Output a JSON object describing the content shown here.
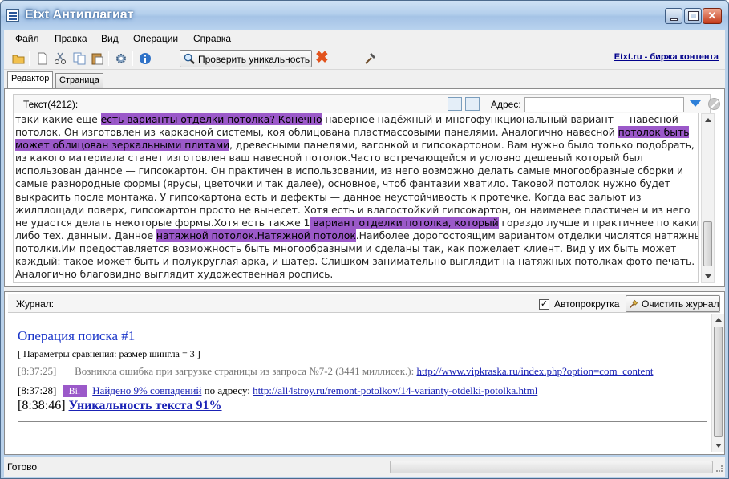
{
  "window": {
    "title": "Etxt Антиплагиат",
    "minimize_glyph": "",
    "close_glyph": "✕"
  },
  "menu": [
    "Файл",
    "Правка",
    "Вид",
    "Операции",
    "Справка"
  ],
  "toolbar": {
    "check_label": "Проверить уникальность",
    "link_label": "Etxt.ru - биржа контента"
  },
  "tabs": [
    "Редактор",
    "Страница"
  ],
  "editor": {
    "text_label": "Текст(4212):",
    "address_label": "Адрес:",
    "address_value": "",
    "lines": [
      [
        {
          "t": "таки какие еще "
        },
        {
          "t": "есть варианты отделки потолка? Конечно",
          "h": true
        },
        {
          "t": " наверное надёжный и многофункциональный вариант — навесной"
        }
      ],
      [
        {
          "t": "потолок. Он изготовлен из каркасной системы, коя облицована пластмассовыми панелями. Аналогично навесной "
        },
        {
          "t": "потолок быть",
          "h": true
        }
      ],
      [
        {
          "t": "может облицован зеркальными плитами",
          "h": true
        },
        {
          "t": ", древесными панелями, вагонкой и гипсокартоном. Вам нужно было только подобрать,"
        }
      ],
      [
        {
          "t": "из какого материала станет изготовлен ваш навесной потолок.Часто встречающейся и условно дешевый который был"
        }
      ],
      [
        {
          "t": "использован данное — гипсокартон. Он практичен в использовании, из него возможно делать самые многообразные сборки и"
        }
      ],
      [
        {
          "t": "самые разнородные формы (ярусы, цветочки и так далее), основное, чтоб фантазии хватило. Таковой потолок нужно будет"
        }
      ],
      [
        {
          "t": "выкрасить после монтажа. У гипсокартона есть и дефекты — данное неустойчивость к протечке. Когда вас зальют из"
        }
      ],
      [
        {
          "t": "жилплощади поверх, гипсокартон просто не вынесет. Хотя есть и влагостойкий гипсокартон, он наименее пластичен и из него"
        }
      ],
      [
        {
          "t": "не удастся делать некоторые формы.Хотя есть также 1"
        },
        {
          "t": " вариант отделки потолка, который",
          "h": true
        },
        {
          "t": " гораздо лучше и практичнее по каким-"
        }
      ],
      [
        {
          "t": "либо тех. данным. Данное "
        },
        {
          "t": "натяжной потолок.Натяжной потолок",
          "h": true
        },
        {
          "t": ".Наиболее дорогостоящим вариантом отделки числятся натяжные"
        }
      ],
      [
        {
          "t": "потолки.Им предоставляется возможность быть многообразными и сделаны так, как пожелает клиент. Вид у их быть может"
        }
      ],
      [
        {
          "t": "каждый: такое может быть и полукруглая арка, и шатер. Слишком занимательно выглядит на натяжных потолках фото печать."
        }
      ],
      [
        {
          "t": "Аналогично благовидно выглядит художественная роспись."
        }
      ]
    ]
  },
  "journal": {
    "label": "Журнал:",
    "autoscroll_label": "Автопрокрутка",
    "autoscroll_checked": true,
    "clear_label": "Очистить журнал",
    "title": "Операция поиска #1",
    "params": "[ Параметры сравнения: размер шингла = 3 ]",
    "error_time": "[8:37:25]",
    "error_msg": "Возникла ошибка при загрузке страницы из запроса №7-2 (3441 миллисек.):",
    "error_url": "http://www.vipkraska.ru/index.php?option=com_content",
    "found_time": "[8:37:28]",
    "found_badge": "Bi.",
    "found_link": "Найдено 9% совпадений",
    "found_text": "по адресу:",
    "found_url": "http://all4stroy.ru/remont-potolkov/14-varianty-otdelki-potolka.html",
    "final_time": "[8:38:46]",
    "final_link": "Уникальность текста 91%"
  },
  "status": {
    "text": "Готово"
  }
}
